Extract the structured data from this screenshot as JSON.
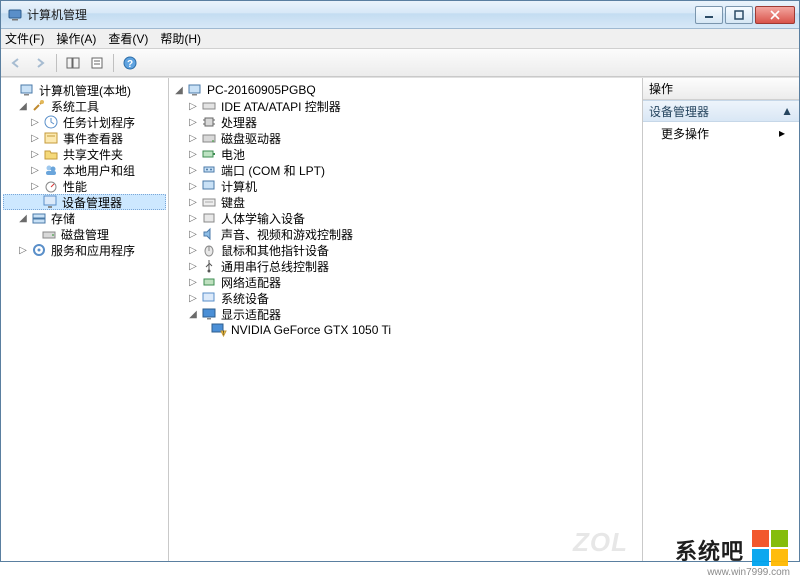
{
  "window": {
    "title": "计算机管理"
  },
  "menus": {
    "file": "文件(F)",
    "action": "操作(A)",
    "view": "查看(V)",
    "help": "帮助(H)"
  },
  "left": {
    "root": "计算机管理(本地)",
    "syst": "系统工具",
    "task": "任务计划程序",
    "event": "事件查看器",
    "shared": "共享文件夹",
    "users": "本地用户和组",
    "perf": "性能",
    "devmgr": "设备管理器",
    "storage": "存储",
    "disk": "磁盘管理",
    "services": "服务和应用程序"
  },
  "mid": {
    "pc": "PC-20160905PGBQ",
    "ide": "IDE ATA/ATAPI 控制器",
    "cpu": "处理器",
    "diskdrv": "磁盘驱动器",
    "battery": "电池",
    "ports": "端口 (COM 和 LPT)",
    "computer": "计算机",
    "keyboard": "键盘",
    "hid": "人体学输入设备",
    "sound": "声音、视频和游戏控制器",
    "mouse": "鼠标和其他指针设备",
    "usb": "通用串行总线控制器",
    "net": "网络适配器",
    "sysdev": "系统设备",
    "display": "显示适配器",
    "gpu": "NVIDIA GeForce GTX 1050 Ti"
  },
  "right": {
    "header": "操作",
    "section": "设备管理器",
    "more": "更多操作"
  },
  "watermark": {
    "brand": "系统吧",
    "url": "www.win7999.com",
    "zol": "ZOL"
  }
}
